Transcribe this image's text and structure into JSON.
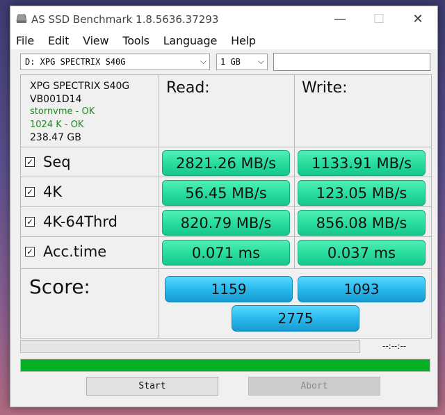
{
  "window": {
    "title": "AS SSD Benchmark 1.8.5636.37293",
    "controls": {
      "minimize": "—",
      "maximize": "☐",
      "close": "✕"
    }
  },
  "menu": [
    "File",
    "Edit",
    "View",
    "Tools",
    "Language",
    "Help"
  ],
  "drive_select": {
    "value": "D: XPG SPECTRIX S40G"
  },
  "size_select": {
    "value": "1 GB"
  },
  "drive_info": {
    "model": "XPG SPECTRIX S40G",
    "firmware": "VB001D14",
    "driver_status": "stornvme - OK",
    "alignment_status": "1024 K - OK",
    "capacity": "238.47 GB"
  },
  "columns": {
    "read": "Read:",
    "write": "Write:"
  },
  "tests": [
    {
      "label": "Seq",
      "checked": true,
      "read": "2821.26 MB/s",
      "write": "1133.91 MB/s"
    },
    {
      "label": "4K",
      "checked": true,
      "read": "56.45 MB/s",
      "write": "123.05 MB/s"
    },
    {
      "label": "4K-64Thrd",
      "checked": true,
      "read": "820.79 MB/s",
      "write": "856.08 MB/s"
    },
    {
      "label": "Acc.time",
      "checked": true,
      "read": "0.071 ms",
      "write": "0.037 ms"
    }
  ],
  "score": {
    "label": "Score:",
    "read": "1159",
    "write": "1093",
    "total": "2775"
  },
  "status": {
    "time_readout": "--:--:--",
    "progress": 1.0
  },
  "buttons": {
    "start": "Start",
    "abort": "Abort"
  },
  "colors": {
    "result_green": "#2ce0a2",
    "score_blue": "#2dbcf0",
    "progress_green": "#06b025",
    "ok_text": "#1a8a1a"
  }
}
